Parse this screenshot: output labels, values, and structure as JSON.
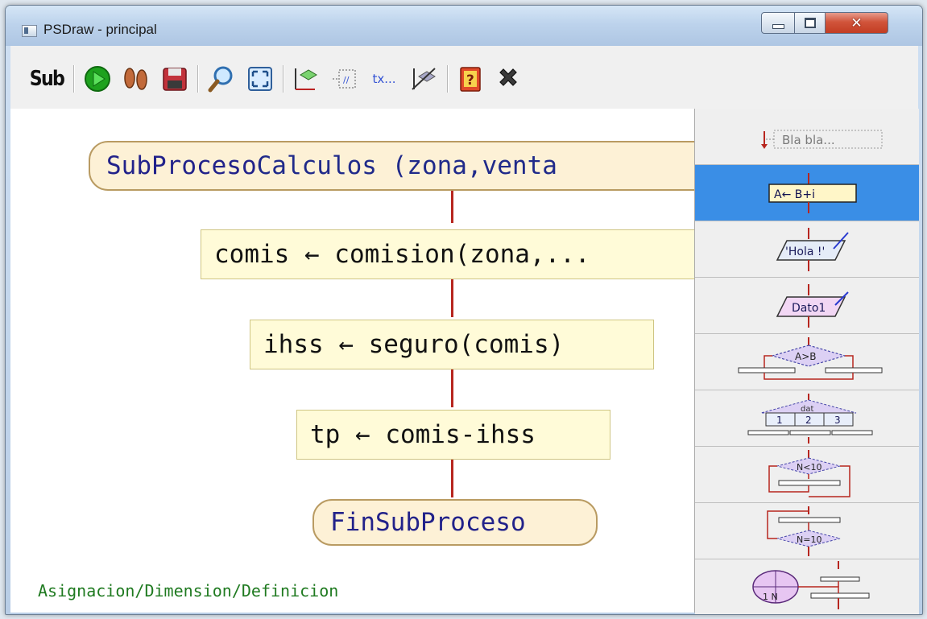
{
  "window": {
    "title": "PSDraw - principal",
    "close_glyph": "✕"
  },
  "toolbar": {
    "sub_label": "Sub",
    "tx_label": "tx..."
  },
  "flowchart": {
    "start": {
      "keyword": "SubProceso",
      "rest": " Calculos (zona,venta"
    },
    "steps": [
      {
        "text": "comis ← comision(zona,..."
      },
      {
        "text": "ihss ← seguro(comis)"
      },
      {
        "text": "tp ← comis-ihss"
      }
    ],
    "end": {
      "keyword": "FinSubProceso"
    },
    "arrow_color": "#b7261f",
    "status_text": "Asignacion/Dimension/Definicion"
  },
  "palette": {
    "selected_index": 1,
    "items": [
      {
        "name": "comment",
        "label": "Bla bla..."
      },
      {
        "name": "assignment",
        "label": "A← B+i"
      },
      {
        "name": "output",
        "label": "'Hola !'"
      },
      {
        "name": "input",
        "label": "Dato1"
      },
      {
        "name": "if",
        "label": "A>B"
      },
      {
        "name": "switch",
        "label": "dat",
        "cases": [
          "1",
          "2",
          "3"
        ]
      },
      {
        "name": "while",
        "label": "N<10"
      },
      {
        "name": "repeat",
        "label": "N=10"
      },
      {
        "name": "for",
        "label": "1 N"
      }
    ]
  },
  "colors": {
    "accent": "#3a8ee6",
    "terminal_fill": "#fdf1d6",
    "process_fill": "#fffbd8",
    "status_text": "#1f7a20"
  }
}
